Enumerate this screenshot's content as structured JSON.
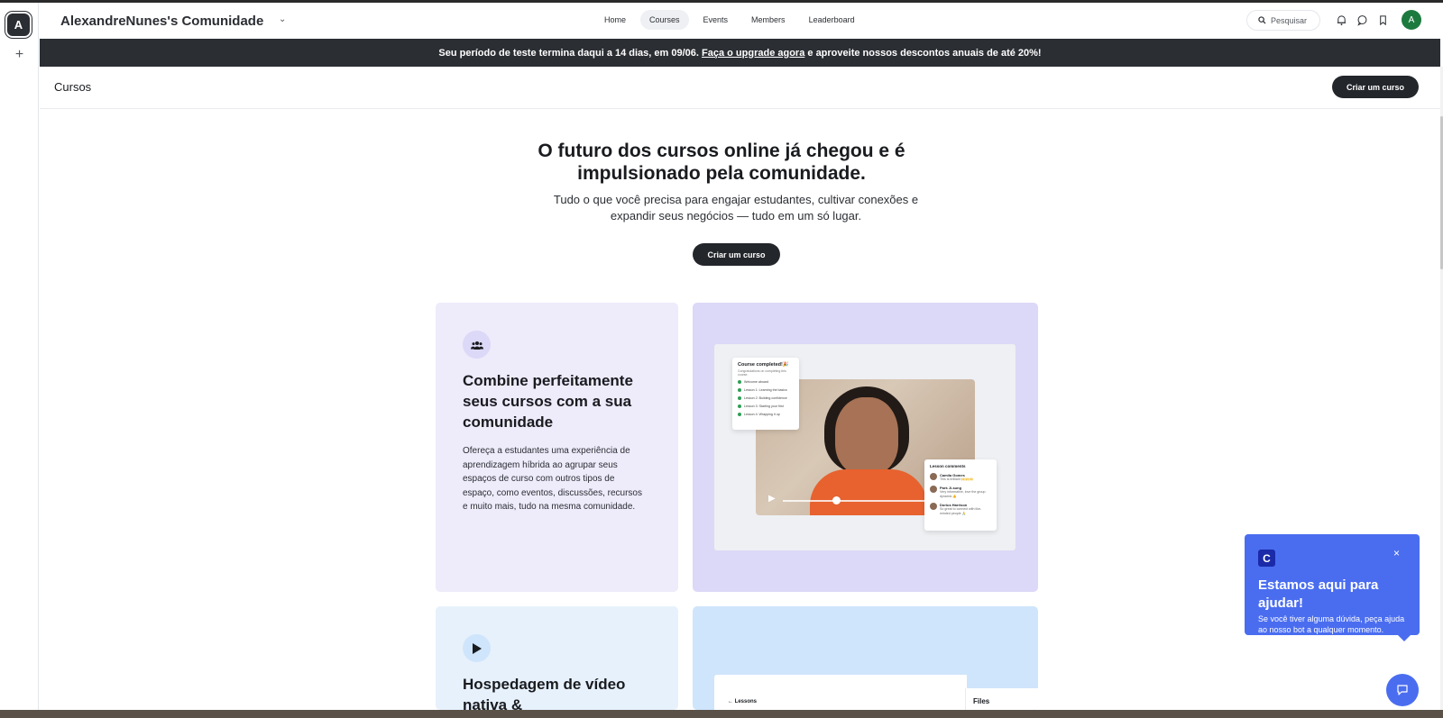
{
  "rail": {
    "avatar_letter": "A",
    "add_symbol": "+"
  },
  "header": {
    "community_name": "AlexandreNunes's Comunidade",
    "nav": [
      {
        "label": "Home",
        "active": false
      },
      {
        "label": "Courses",
        "active": true
      },
      {
        "label": "Events",
        "active": false
      },
      {
        "label": "Members",
        "active": false
      },
      {
        "label": "Leaderboard",
        "active": false
      }
    ],
    "search_placeholder": "Pesquisar",
    "icons": [
      "search-icon",
      "bell-icon",
      "chat-bubble-icon",
      "bookmark-icon"
    ],
    "user_avatar_letter": "A"
  },
  "banner": {
    "text_before": "Seu período de teste termina daqui a 14 dias, em 09/06.",
    "link": "Faça o upgrade agora",
    "text_after": "e aproveite nossos descontos anuais de até 20%!"
  },
  "page": {
    "title": "Cursos",
    "create_button": "Criar um curso"
  },
  "hero": {
    "title": "O futuro dos cursos online já chegou e é impulsionado pela comunidade.",
    "subtitle": "Tudo o que você precisa para engajar estudantes, cultivar conexões e expandir seus negócios — tudo em um só lugar.",
    "button": "Criar um curso"
  },
  "features": [
    {
      "icon": "people-icon",
      "title": "Combine perfeitamente seus cursos com a sua comunidade",
      "text": "Ofereça a estudantes uma experiência de aprendizagem híbrida ao agrupar seus espaços de curso com outros tipos de espaço, como eventos, discussões, recursos e muito mais, tudo na mesma comunidade."
    },
    {
      "icon": "play-icon",
      "title": "Hospedagem de vídeo nativa &"
    }
  ],
  "mockup": {
    "completed_title": "Course completed!🎉",
    "completed_sub": "Congratulations on completing this course.",
    "lessons": [
      "Welcome aboard",
      "Lesson 1: Learning the basics",
      "Lesson 2: Building confidence",
      "Lesson 3: Starting your first",
      "Lesson 4: Wrapping it up"
    ],
    "comments_title": "Lesson comments",
    "comments": [
      {
        "name": "Camila Gomes",
        "text": "This is brilliant 🙌🙌🙌"
      },
      {
        "name": "Park Ji-sung",
        "text": "Very informative, love the group dynamic 👍"
      },
      {
        "name": "Dorius Harrison",
        "text": "So great to connect with like-minded people 🙏"
      }
    ],
    "lessons_label": "Lessons",
    "files_label": "Files"
  },
  "help": {
    "logo_letter": "C",
    "title": "Estamos aqui para ajudar!",
    "text": "Se você tiver alguma dúvida, peça ajuda ao nosso bot a qualquer momento.",
    "close_symbol": "×"
  },
  "colors": {
    "dark": "#2b2e33",
    "accent_blue": "#4a6df0",
    "card_purple_light": "#eeebfb",
    "card_purple": "#dcd8f7",
    "card_blue_light": "#e7f1fc",
    "card_blue": "#cfe5fb"
  }
}
